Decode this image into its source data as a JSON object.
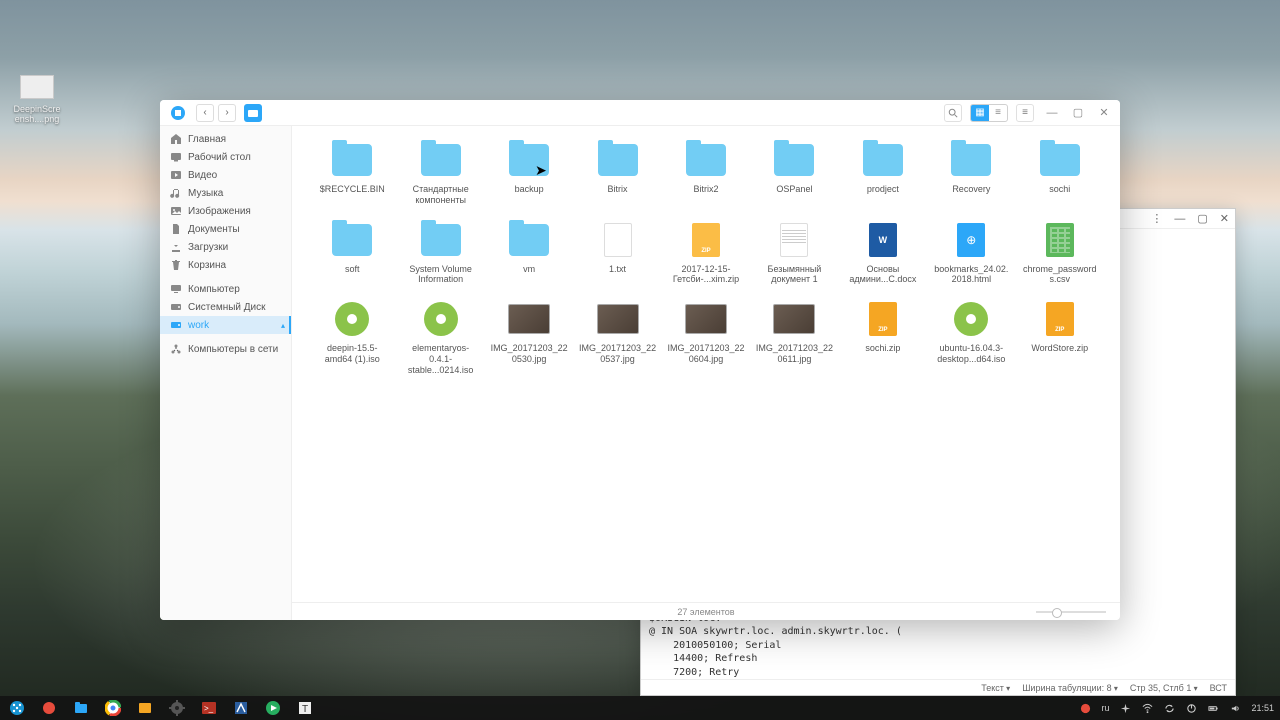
{
  "desktop_icon": {
    "label": "DeepinScreensh....png"
  },
  "file_manager": {
    "sidebar": [
      {
        "id": "home",
        "label": "Главная",
        "icon": "home"
      },
      {
        "id": "desktop",
        "label": "Рабочий стол",
        "icon": "desktop"
      },
      {
        "id": "video",
        "label": "Видео",
        "icon": "video"
      },
      {
        "id": "music",
        "label": "Музыка",
        "icon": "music"
      },
      {
        "id": "pictures",
        "label": "Изображения",
        "icon": "image"
      },
      {
        "id": "documents",
        "label": "Документы",
        "icon": "doc"
      },
      {
        "id": "downloads",
        "label": "Загрузки",
        "icon": "download"
      },
      {
        "id": "trash",
        "label": "Корзина",
        "icon": "trash"
      },
      {
        "id": "sep"
      },
      {
        "id": "computer",
        "label": "Компьютер",
        "icon": "computer"
      },
      {
        "id": "sysdisk",
        "label": "Системный Диск",
        "icon": "disk"
      },
      {
        "id": "work",
        "label": "work",
        "icon": "disk",
        "active": true
      },
      {
        "id": "sep"
      },
      {
        "id": "network",
        "label": "Компьютеры в сети",
        "icon": "network"
      }
    ],
    "items": [
      {
        "type": "folder",
        "name": "$RECYCLE.BIN"
      },
      {
        "type": "folder",
        "name": "Стандартные компоненты"
      },
      {
        "type": "folder",
        "name": "backup"
      },
      {
        "type": "folder",
        "name": "Bitrix"
      },
      {
        "type": "folder",
        "name": "Bitrix2"
      },
      {
        "type": "folder",
        "name": "OSPanel"
      },
      {
        "type": "folder",
        "name": "prodject"
      },
      {
        "type": "folder",
        "name": "Recovery"
      },
      {
        "type": "folder",
        "name": "sochi"
      },
      {
        "type": "folder",
        "name": "soft"
      },
      {
        "type": "folder",
        "name": "System Volume Information"
      },
      {
        "type": "folder",
        "name": "vm"
      },
      {
        "type": "txt",
        "name": "1.txt"
      },
      {
        "type": "zip",
        "name": "2017-12-15-Гетсби-...xim.zip"
      },
      {
        "type": "txtlines",
        "name": "Безымянный документ 1"
      },
      {
        "type": "docx",
        "name": "Основы админи...C.docx"
      },
      {
        "type": "html",
        "name": "bookmarks_24.02.2018.html"
      },
      {
        "type": "csv",
        "name": "chrome_passwords.csv"
      },
      {
        "type": "iso",
        "name": "deepin-15.5-amd64 (1).iso"
      },
      {
        "type": "iso",
        "name": "elementaryos-0.4.1-stable...0214.iso"
      },
      {
        "type": "img",
        "name": "IMG_20171203_220530.jpg"
      },
      {
        "type": "img",
        "name": "IMG_20171203_220537.jpg"
      },
      {
        "type": "img",
        "name": "IMG_20171203_220604.jpg"
      },
      {
        "type": "img",
        "name": "IMG_20171203_220611.jpg"
      },
      {
        "type": "zip2",
        "name": "sochi.zip"
      },
      {
        "type": "iso",
        "name": "ubuntu-16.04.3-desktop...d64.iso"
      },
      {
        "type": "zip2",
        "name": "WordStore.zip"
      }
    ],
    "status": "27 элементов"
  },
  "editor": {
    "code": "$ORIGIN loc.\n@ IN SOA skywrtr.loc. admin.skywrtr.loc. (\n    2010050100; Serial\n    14400; Refresh\n    7200; Retry",
    "status_syntax": "Текст",
    "status_tab": "Ширина табуляции: 8",
    "status_pos": "Стр 35, Стлб 1",
    "status_mode": "ВСТ"
  },
  "tray": {
    "lang": "ru",
    "clock": "21:51"
  }
}
